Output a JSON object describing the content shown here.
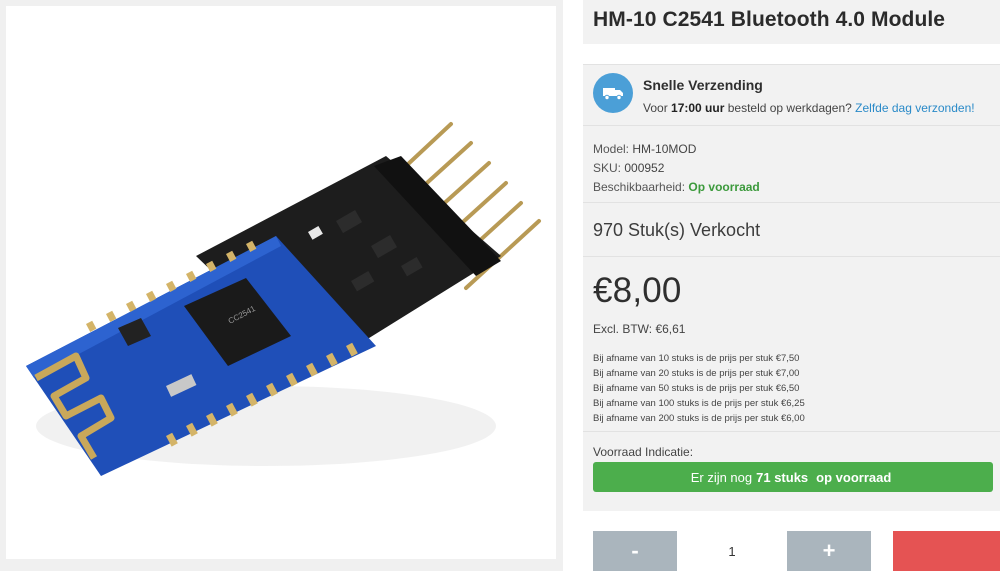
{
  "product": {
    "title": "HM-10 C2541 Bluetooth 4.0 Module",
    "image_alt_icon": "bluetooth-module-photo"
  },
  "shipping": {
    "icon": "truck-icon",
    "title": "Snelle Verzending",
    "text_before": "Voor ",
    "time": "17:00 uur",
    "text_after": " besteld op werkdagen? ",
    "link": "Zelfde dag verzonden!"
  },
  "meta": {
    "model_label": "Model:",
    "model_value": "HM-10MOD",
    "sku_label": "SKU:",
    "sku_value": "000952",
    "availability_label": "Beschikbaarheid:",
    "availability_value": "Op voorraad"
  },
  "sold": "970 Stuk(s) Verkocht",
  "pricing": {
    "price": "€8,00",
    "excl_vat": "Excl. BTW: €6,61",
    "tiers": [
      "Bij afname van 10 stuks is de prijs per stuk €7,50",
      "Bij afname van 20 stuks is de prijs per stuk €7,00",
      "Bij afname van 50 stuks is de prijs per stuk €6,50",
      "Bij afname van 100 stuks is de prijs per stuk €6,25",
      "Bij afname van 200 stuks is de prijs per stuk €6,00"
    ]
  },
  "stock": {
    "label": "Voorraad Indicatie:",
    "prefix": "Er zijn nog",
    "count": "71 stuks",
    "suffix": "op voorraad"
  },
  "quantity": {
    "minus": "-",
    "value": "1",
    "plus": "+"
  },
  "colors": {
    "accent_blue": "#4b9fd7",
    "stock_green": "#4cae4c",
    "cart_red": "#e55353",
    "qty_gray": "#aab5bd"
  }
}
